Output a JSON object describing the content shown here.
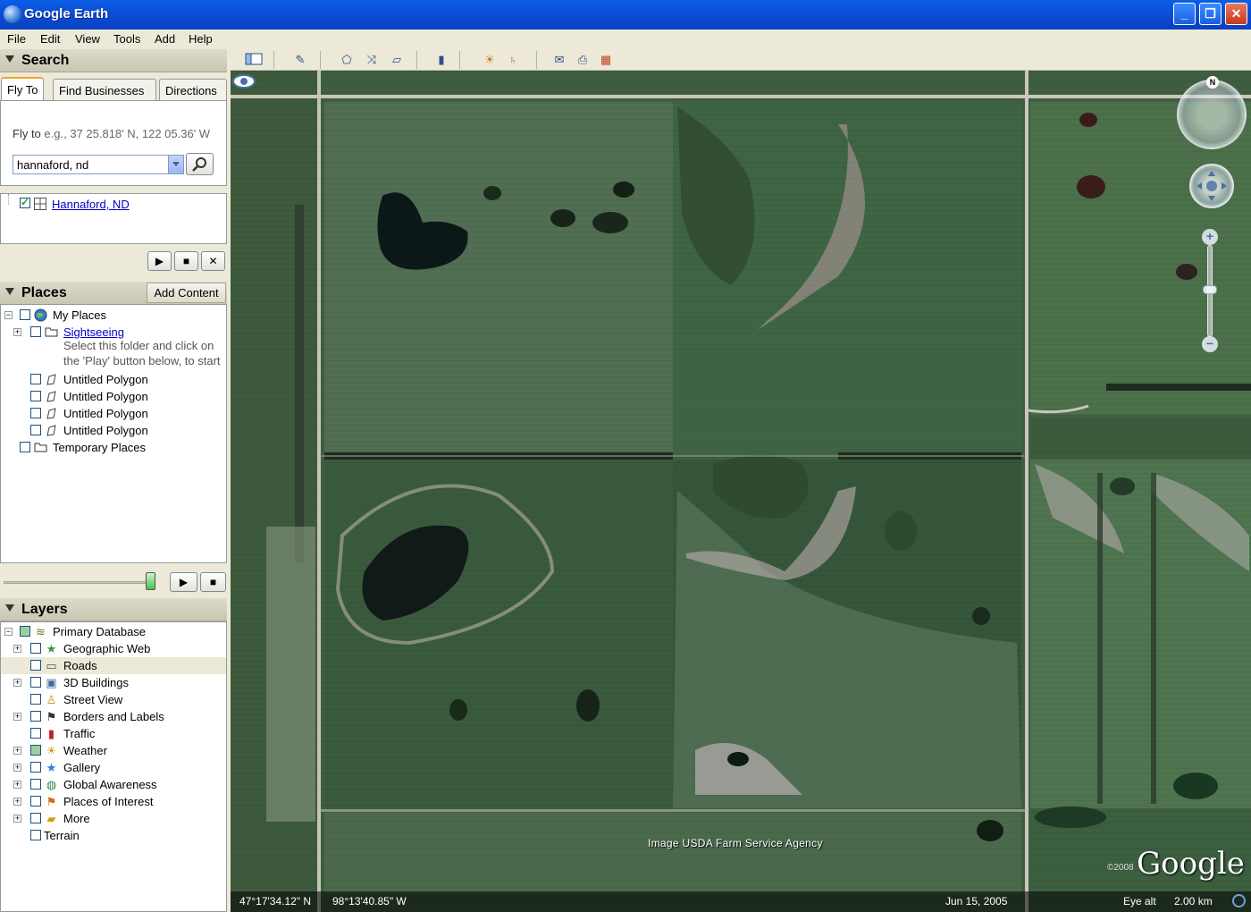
{
  "window": {
    "title": "Google Earth",
    "minimize": "_",
    "maximize": "❐",
    "close": "✕"
  },
  "menu": [
    "File",
    "Edit",
    "View",
    "Tools",
    "Add",
    "Help"
  ],
  "search": {
    "header": "Search",
    "tabs": [
      "Fly To",
      "Find Businesses",
      "Directions"
    ],
    "fly_label": "Fly to",
    "fly_hint": "e.g., 37 25.818' N, 122 05.36' W",
    "query_value": "hannaford, nd",
    "result": "Hannaford, ND"
  },
  "places": {
    "header": "Places",
    "add_content": "Add Content",
    "items": [
      {
        "label": "My Places"
      },
      {
        "label": "Sightseeing"
      },
      {
        "label": "Select this folder and click on"
      },
      {
        "label": "the 'Play' button below, to start"
      },
      {
        "label": "Untitled Polygon"
      },
      {
        "label": "Untitled Polygon"
      },
      {
        "label": "Untitled Polygon"
      },
      {
        "label": "Untitled Polygon"
      },
      {
        "label": "Temporary Places"
      }
    ],
    "tour_progress": 0.97
  },
  "layers": {
    "header": "Layers",
    "items": [
      {
        "label": "Primary Database"
      },
      {
        "label": "Geographic Web"
      },
      {
        "label": "Roads"
      },
      {
        "label": "3D Buildings"
      },
      {
        "label": "Street View"
      },
      {
        "label": "Borders and Labels"
      },
      {
        "label": "Traffic"
      },
      {
        "label": "Weather"
      },
      {
        "label": "Gallery"
      },
      {
        "label": "Global Awareness"
      },
      {
        "label": "Places of Interest"
      },
      {
        "label": "More"
      },
      {
        "label": "Terrain"
      }
    ]
  },
  "map": {
    "attribution": "Image USDA Farm Service Agency",
    "copyright_year": "©2008",
    "logo": "Google",
    "latitude": "47°17'34.12\" N",
    "longitude": "98°13'40.85\" W",
    "image_date": "Jun 15, 2005",
    "eye_alt_label": "Eye alt",
    "eye_alt_value": "2.00 km",
    "compass_north": "N",
    "zoom_in": "+",
    "zoom_out": "−"
  },
  "controls": {
    "play": "▶",
    "stop": "■",
    "close": "✕"
  }
}
